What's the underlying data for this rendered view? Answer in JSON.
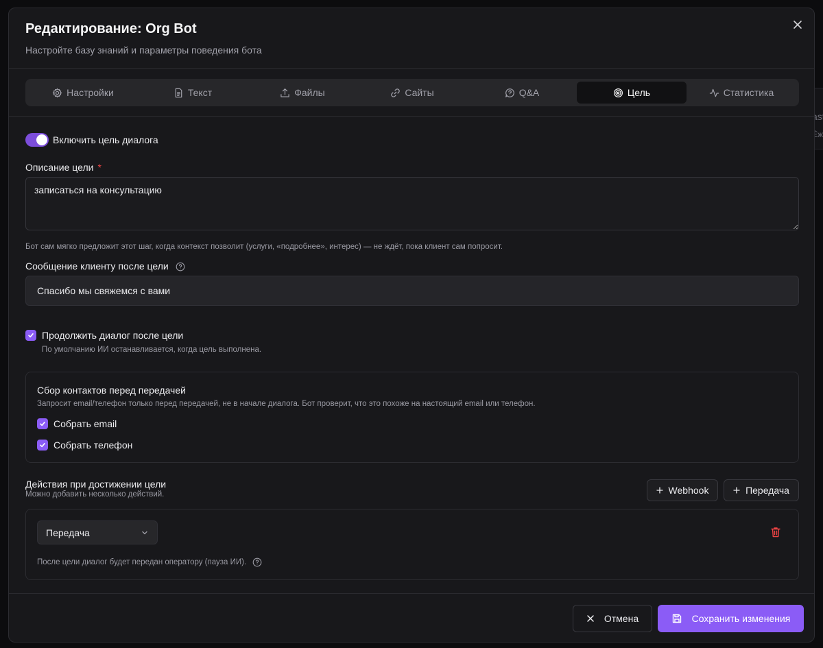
{
  "background": {
    "peek_text_1": "ast",
    "peek_text_2": "Ѐж"
  },
  "modal": {
    "title": "Редактирование: Org Bot",
    "subtitle": "Настройте базу знаний и параметры поведения бота"
  },
  "tabs": [
    {
      "label": "Настройки",
      "icon": "gear-icon",
      "active": false
    },
    {
      "label": "Текст",
      "icon": "file-text-icon",
      "active": false
    },
    {
      "label": "Файлы",
      "icon": "upload-icon",
      "active": false
    },
    {
      "label": "Сайты",
      "icon": "link-icon",
      "active": false
    },
    {
      "label": "Q&A",
      "icon": "message-question-icon",
      "active": false
    },
    {
      "label": "Цель",
      "icon": "target-icon",
      "active": true
    },
    {
      "label": "Статистика",
      "icon": "activity-icon",
      "active": false
    }
  ],
  "goal": {
    "toggle_label": "Включить цель диалога",
    "toggle_on": true,
    "description_label": "Описание цели",
    "description_required_mark": "*",
    "description_value": "записаться на консультацию",
    "description_hint": "Бот сам мягко предложит этот шаг, когда контекст позволит (услуги, «подробнее», интерес) — не ждёт, пока клиент сам попросит.",
    "message_label": "Сообщение клиенту после цели",
    "message_value": "Спасибо мы свяжемся с вами",
    "continue_label": "Продолжить диалог после цели",
    "continue_checked": true,
    "continue_hint": "По умолчанию ИИ останавливается, когда цель выполнена."
  },
  "contacts": {
    "title": "Сбор контактов перед передачей",
    "hint": "Запросит email/телефон только перед передачей, не в начале диалога. Бот проверит, что это похоже на настоящий email или телефон.",
    "collect_email_label": "Собрать email",
    "collect_email_checked": true,
    "collect_phone_label": "Собрать телефон",
    "collect_phone_checked": true
  },
  "actions": {
    "title": "Действия при достижении цели",
    "hint": "Можно добавить несколько действий.",
    "add_webhook_label": "Webhook",
    "add_transfer_label": "Передача",
    "item_select_value": "Передача",
    "item_hint": "После цели диалог будет передан оператору (пауза ИИ)."
  },
  "footer": {
    "cancel_label": "Отмена",
    "save_label": "Сохранить изменения"
  },
  "colors": {
    "accent": "#8b5cf6",
    "toggle_on": "#7c4ddb",
    "danger": "#ef4444",
    "modal_bg": "#18181b"
  }
}
